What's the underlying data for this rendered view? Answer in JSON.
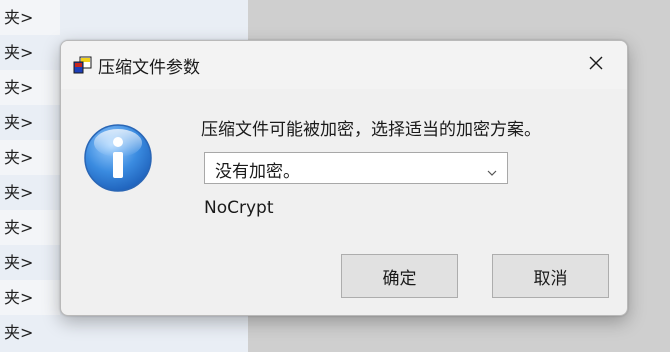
{
  "background": {
    "list_items": [
      "夹>",
      "夹>",
      "夹>",
      "夹>",
      "夹>",
      "夹>",
      "夹>",
      "夹>",
      "夹>",
      "夹>"
    ]
  },
  "dialog": {
    "title": "压缩文件参数",
    "app_icon": "archive-app-icon",
    "close_icon": "close-icon",
    "info_icon": "info-icon",
    "message": "压缩文件可能被加密，选择适当的加密方案。",
    "encryption_select": {
      "selected": "没有加密。"
    },
    "encryption_code": "NoCrypt",
    "ok_label": "确定",
    "cancel_label": "取消"
  },
  "colors": {
    "dialog_bg": "#f0f0f0",
    "info_blue": "#2f7fd0",
    "button_bg": "#e1e1e1"
  }
}
